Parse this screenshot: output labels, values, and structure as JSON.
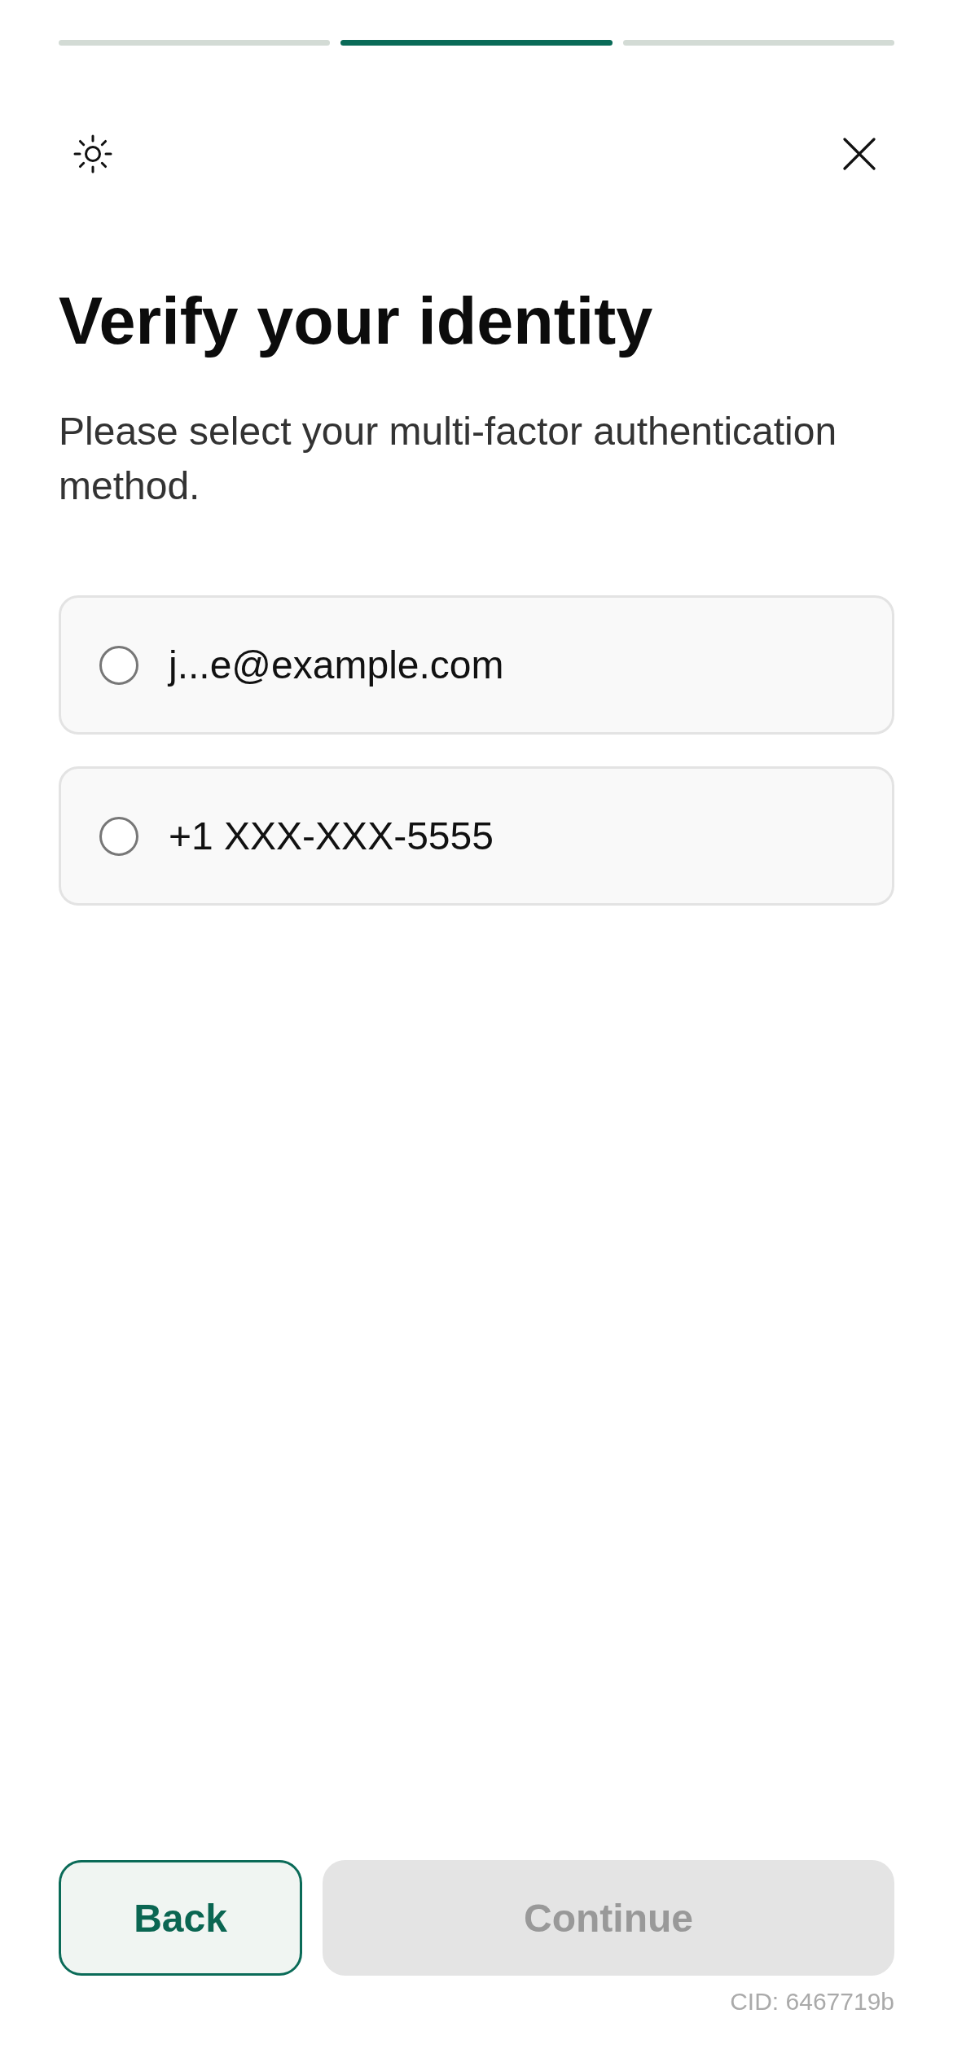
{
  "progress": {
    "steps": [
      {
        "current": false
      },
      {
        "current": true
      },
      {
        "current": false
      }
    ]
  },
  "title": "Verify your identity",
  "subtitle": "Please select your multi-factor authentication method.",
  "options": [
    {
      "label": "j...e@example.com",
      "selected": false
    },
    {
      "label": "+1 XXX-XXX-5555",
      "selected": false
    }
  ],
  "buttons": [
    {
      "label": "Back",
      "kind": "secondary",
      "disabled": false
    },
    {
      "label": "Continue",
      "kind": "primary",
      "disabled": true
    }
  ],
  "cid": "CID: 6467719b"
}
